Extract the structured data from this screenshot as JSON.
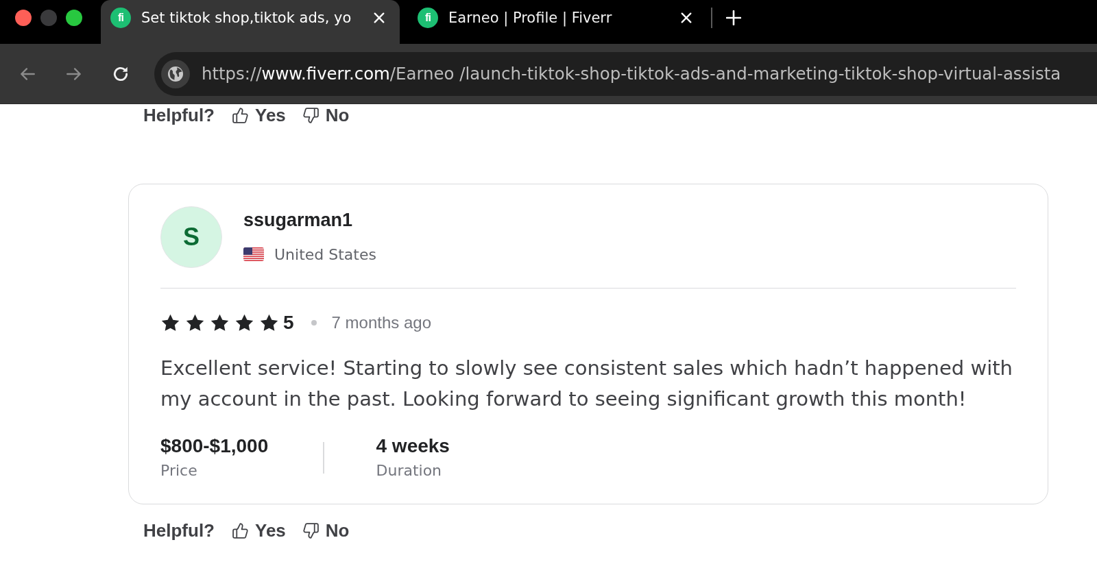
{
  "window": {
    "tabs": [
      {
        "favicon": "fi",
        "title": "Set tiktok shop,tiktok ads, yo",
        "selected": true
      },
      {
        "favicon": "fi",
        "title": "Earneo | Profile | Fiverr",
        "selected": false
      }
    ]
  },
  "toolbar": {
    "buttons": [
      {
        "kind": "back",
        "disabled": true
      },
      {
        "kind": "forward",
        "disabled": true
      },
      {
        "kind": "reload",
        "disabled": false
      }
    ],
    "url": {
      "scheme": "https://",
      "host": "www.fiverr.com",
      "path": "/Earneo /launch-tiktok-shop-tiktok-ads-and-marketing-tiktok-shop-virtual-assista"
    }
  },
  "helpful_top": {
    "label": "Helpful?",
    "yes": "Yes",
    "no": "No"
  },
  "review": {
    "avatar_letter": "S",
    "username": "ssugarman1",
    "country": "United States",
    "stars": 5,
    "rating": "5",
    "time": "7 months ago",
    "text": "Excellent service! Starting to slowly see consistent sales which hadn’t happened with my account in the past. Looking forward to seeing significant growth this month!",
    "price": "$800-$1,000",
    "price_label": "Price",
    "duration": "4 weeks",
    "duration_label": "Duration"
  },
  "helpful_bottom": {
    "label": "Helpful?",
    "yes": "Yes",
    "no": "No"
  }
}
